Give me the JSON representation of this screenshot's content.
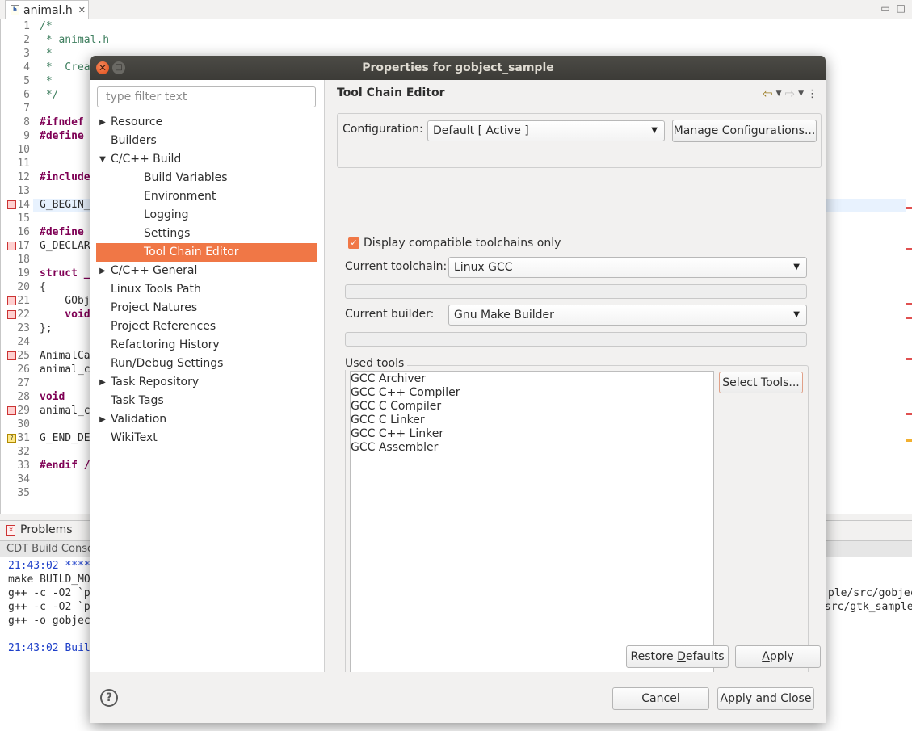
{
  "editor": {
    "tab_label": "animal.h",
    "file_icon_label": "h",
    "line_numbers": [
      "1",
      "2",
      "3",
      "4",
      "5",
      "6",
      "7",
      "8",
      "9",
      "10",
      "11",
      "12",
      "13",
      "14",
      "15",
      "16",
      "17",
      "18",
      "19",
      "20",
      "21",
      "22",
      "23",
      "24",
      "25",
      "26",
      "27",
      "28",
      "29",
      "30",
      "31",
      "32",
      "33",
      "34",
      "35"
    ],
    "code_lines": [
      "/*",
      " * animal.h",
      " *",
      " *  Crea",
      " *",
      " */",
      "",
      "#ifndef",
      "#define",
      "",
      "",
      "#include",
      "",
      "G_BEGIN_",
      "",
      "#define",
      "G_DECLAR",
      "",
      "struct _",
      "{",
      "    GObj",
      "    void",
      "};",
      "",
      "AnimalCa",
      "animal_c",
      "",
      "void",
      "animal_c",
      "",
      "G_END_DE",
      "",
      "#endif /",
      "",
      ""
    ]
  },
  "bottom_panel": {
    "problems_tab": "Problems",
    "console_header": "CDT Build Conso",
    "console_lines": [
      "21:43:02 ****",
      "make BUILD_MO",
      "g++ -c -O2 `p",
      "g++ -c -O2 `p",
      "g++ -o gobjec",
      "",
      "21:43:02 Buil"
    ],
    "console_right": [
      "ple/src/gobjec",
      "src/gtk_sample"
    ]
  },
  "dialog": {
    "title": "Properties for gobject_sample",
    "filter_placeholder": "type filter text",
    "nav_items": [
      {
        "label": "Resource",
        "level": 0,
        "arrow": "right"
      },
      {
        "label": "Builders",
        "level": 0,
        "arrow": ""
      },
      {
        "label": "C/C++ Build",
        "level": 0,
        "arrow": "down"
      },
      {
        "label": "Build Variables",
        "level": 1,
        "arrow": ""
      },
      {
        "label": "Environment",
        "level": 1,
        "arrow": ""
      },
      {
        "label": "Logging",
        "level": 1,
        "arrow": ""
      },
      {
        "label": "Settings",
        "level": 1,
        "arrow": ""
      },
      {
        "label": "Tool Chain Editor",
        "level": 1,
        "arrow": "",
        "selected": true
      },
      {
        "label": "C/C++ General",
        "level": 0,
        "arrow": "right"
      },
      {
        "label": "Linux Tools Path",
        "level": 0,
        "arrow": ""
      },
      {
        "label": "Project Natures",
        "level": 0,
        "arrow": ""
      },
      {
        "label": "Project References",
        "level": 0,
        "arrow": ""
      },
      {
        "label": "Refactoring History",
        "level": 0,
        "arrow": ""
      },
      {
        "label": "Run/Debug Settings",
        "level": 0,
        "arrow": ""
      },
      {
        "label": "Task Repository",
        "level": 0,
        "arrow": "right"
      },
      {
        "label": "Task Tags",
        "level": 0,
        "arrow": ""
      },
      {
        "label": "Validation",
        "level": 0,
        "arrow": "right"
      },
      {
        "label": "WikiText",
        "level": 0,
        "arrow": ""
      }
    ],
    "page_title": "Tool Chain Editor",
    "configuration_label": "Configuration:",
    "configuration_value": "Default  [ Active ]",
    "manage_configurations": "Manage Configurations...",
    "display_compatible": "Display compatible toolchains only",
    "display_compatible_checked": true,
    "current_toolchain_label": "Current toolchain:",
    "current_toolchain_value": "Linux GCC",
    "current_builder_label": "Current builder:",
    "current_builder_value": "Gnu Make Builder",
    "used_tools_label": "Used tools",
    "used_tools": [
      "GCC Archiver",
      "GCC C++ Compiler",
      "GCC C Compiler",
      "GCC C Linker",
      "GCC C++ Linker",
      "GCC Assembler"
    ],
    "select_tools": "Select Tools...",
    "restore_defaults_pre": "Restore ",
    "restore_defaults_acc": "D",
    "restore_defaults_post": "efaults",
    "apply_acc": "A",
    "apply_post": "pply",
    "cancel": "Cancel",
    "apply_and_close": "Apply and Close",
    "accent_color": "#f07746"
  }
}
